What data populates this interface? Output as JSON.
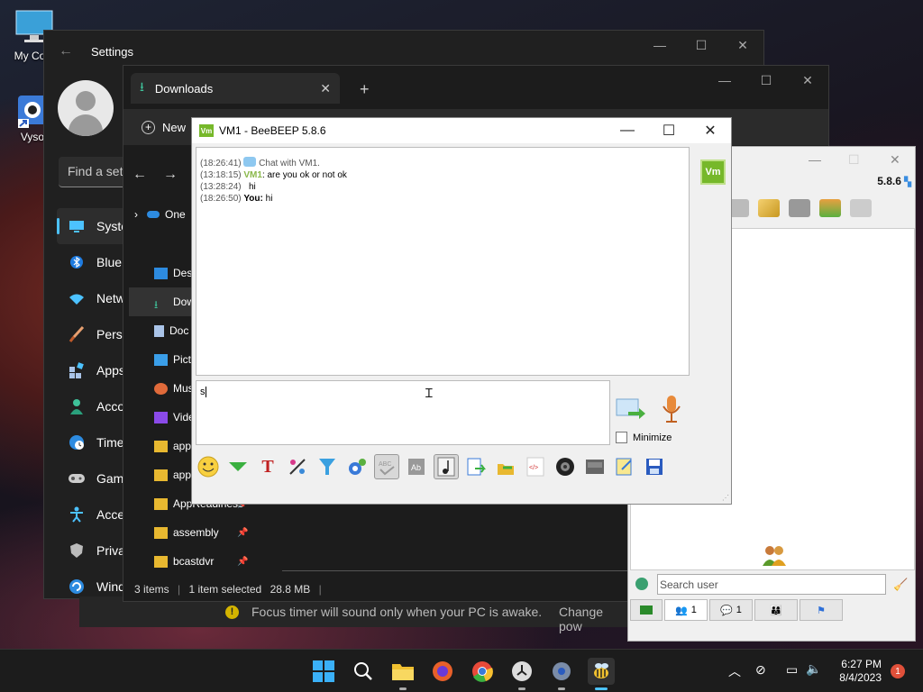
{
  "desktop": {
    "icons": [
      {
        "label": "My Com"
      },
      {
        "label": "Vyso"
      }
    ]
  },
  "settings": {
    "title": "Settings",
    "search_placeholder": "Find a set",
    "nav": [
      {
        "label": "Syste",
        "icon": "monitor-icon"
      },
      {
        "label": "Blue",
        "icon": "bluetooth-icon"
      },
      {
        "label": "Netw",
        "icon": "wifi-icon"
      },
      {
        "label": "Perso",
        "icon": "brush-icon"
      },
      {
        "label": "Apps",
        "icon": "apps-icon"
      },
      {
        "label": "Acco",
        "icon": "person-icon"
      },
      {
        "label": "Time",
        "icon": "globe-clock-icon"
      },
      {
        "label": "Gam",
        "icon": "gamepad-icon"
      },
      {
        "label": "Acce",
        "icon": "accessibility-icon"
      },
      {
        "label": "Priva",
        "icon": "shield-icon"
      },
      {
        "label": "Wind",
        "icon": "update-icon"
      }
    ],
    "focus_message": "Focus timer will sound only when your PC is awake.",
    "focus_link": "Change pow"
  },
  "explorer": {
    "tab_title": "Downloads",
    "new_label": "New",
    "nav_root": "One",
    "sidebar": [
      {
        "label": "Desk",
        "icon": "desktop-icon",
        "pinned": false
      },
      {
        "label": "Dow",
        "icon": "download-icon",
        "pinned": false
      },
      {
        "label": "Doc",
        "icon": "document-icon",
        "pinned": false
      },
      {
        "label": "Pictu",
        "icon": "picture-icon",
        "pinned": false
      },
      {
        "label": "Mus",
        "icon": "music-icon",
        "pinned": false
      },
      {
        "label": "Vide",
        "icon": "video-icon",
        "pinned": false
      },
      {
        "label": "app",
        "icon": "folder-icon",
        "pinned": false
      },
      {
        "label": "app",
        "icon": "folder-icon",
        "pinned": false
      },
      {
        "label": "AppReadiness",
        "icon": "folder-icon",
        "pinned": true
      },
      {
        "label": "assembly",
        "icon": "folder-icon",
        "pinned": true
      },
      {
        "label": "bcastdvr",
        "icon": "folder-icon",
        "pinned": true
      }
    ],
    "status": {
      "items": "3 items",
      "selected": "1 item selected",
      "size": "28.8 MB"
    }
  },
  "beebeep_main": {
    "version": "5.8.6",
    "search_placeholder": "Search user",
    "tabs": [
      {
        "icon": "users-tab-icon",
        "count": ""
      },
      {
        "icon": "group-chat-icon",
        "count": "1"
      },
      {
        "icon": "chat-tab-icon",
        "count": "1"
      },
      {
        "icon": "groups-icon",
        "count": ""
      },
      {
        "icon": "share-icon",
        "count": ""
      }
    ]
  },
  "chat": {
    "title": "VM1 - BeeBEEP 5.8.6",
    "badge": "Vm",
    "messages": [
      {
        "time": "(18:26:41)",
        "sender": "",
        "text": "Chat with VM1.",
        "kind": "system"
      },
      {
        "time": "(13:18:15)",
        "sender": "VM1",
        "text": ": are you ok or not ok",
        "kind": "vm"
      },
      {
        "time": "(13:28:24)",
        "sender": "",
        "text": "hi",
        "kind": "plain"
      },
      {
        "time": "(18:26:50)",
        "sender": "You:",
        "text": " hi",
        "kind": "you"
      }
    ],
    "input_value": "s",
    "minimize_label": "Minimize",
    "side_badge": "Vm"
  },
  "taskbar": {
    "time": "6:27 PM",
    "date": "8/4/2023",
    "notifications": "1"
  },
  "colors": {
    "accent": "#4cc2ff",
    "beebeep_green": "#76b82a"
  }
}
